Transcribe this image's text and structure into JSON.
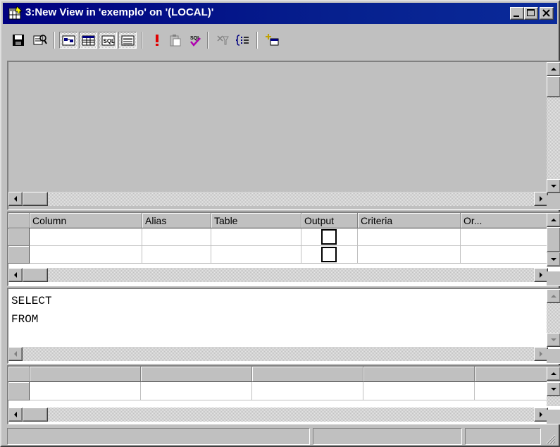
{
  "window": {
    "title": "3:New View in 'exemplo' on '(LOCAL)'",
    "title_bar_color": "#000080"
  },
  "toolbar": {
    "buttons": [
      {
        "name": "save",
        "icon": "floppy-disk-icon"
      },
      {
        "name": "properties",
        "icon": "properties-icon"
      },
      {
        "name": "show-diagram-pane",
        "icon": "diagram-pane-icon",
        "pressed": true
      },
      {
        "name": "show-grid-pane",
        "icon": "grid-pane-icon",
        "pressed": true
      },
      {
        "name": "show-sql-pane",
        "icon": "sql-pane-icon",
        "label": "SQL",
        "pressed": true
      },
      {
        "name": "show-results-pane",
        "icon": "results-pane-icon",
        "pressed": true
      },
      {
        "name": "run",
        "icon": "exclamation-icon"
      },
      {
        "name": "paste",
        "icon": "clipboard-icon"
      },
      {
        "name": "verify-sql",
        "icon": "sql-check-icon",
        "label": "SQL"
      },
      {
        "name": "remove-filter",
        "icon": "remove-filter-icon"
      },
      {
        "name": "use-group-by",
        "icon": "group-by-icon"
      },
      {
        "name": "add-table",
        "icon": "add-table-icon"
      }
    ]
  },
  "grid": {
    "columns": [
      "Column",
      "Alias",
      "Table",
      "Output",
      "Criteria",
      "Or..."
    ],
    "rows": [
      {
        "column": "",
        "alias": "",
        "table": "",
        "output": false,
        "criteria": "",
        "or": ""
      },
      {
        "column": "",
        "alias": "",
        "table": "",
        "output": false,
        "criteria": "",
        "or": ""
      }
    ]
  },
  "sql": {
    "lines": [
      "SELECT",
      "FROM"
    ]
  },
  "status": {
    "panels": [
      "",
      "",
      "",
      ""
    ]
  }
}
